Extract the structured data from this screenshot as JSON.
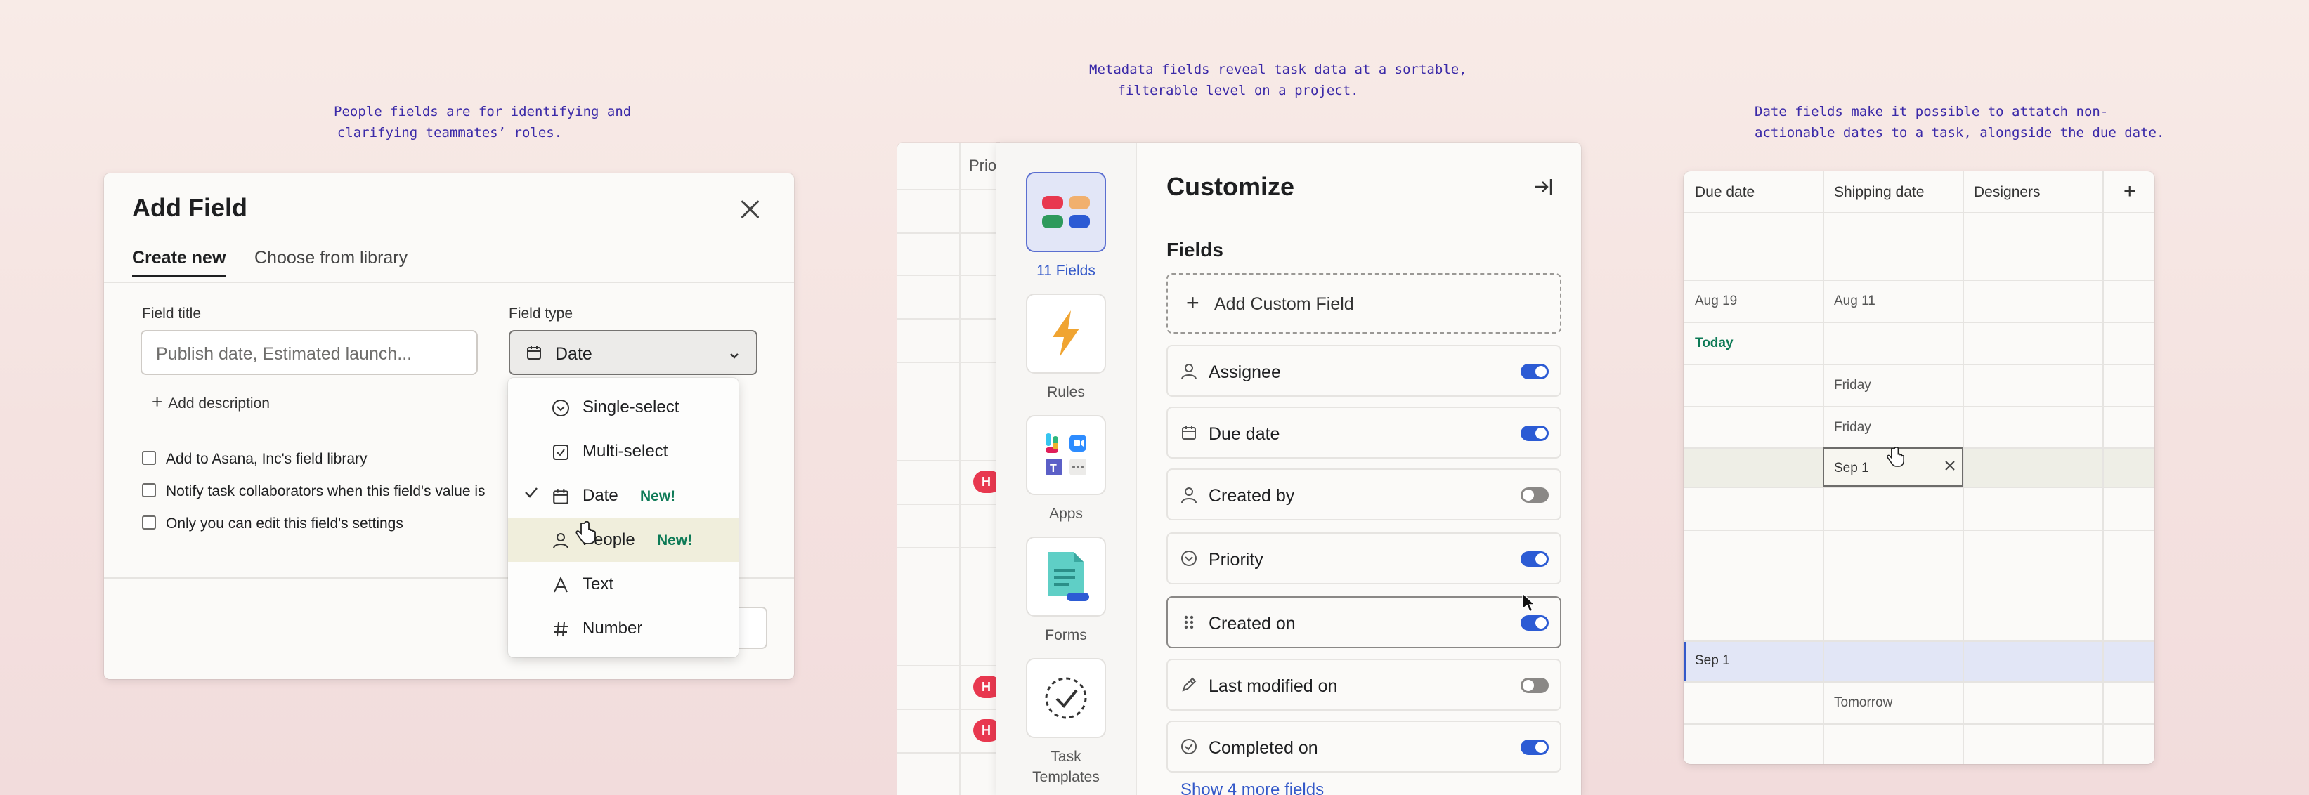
{
  "captions": {
    "people": [
      "People fields are for identifying and",
      "clarifying teammates’ roles."
    ],
    "metadata": [
      "Metadata fields reveal task data at a sortable,",
      "filterable level on a project."
    ],
    "date": [
      "Date fields make it possible to attatch non-",
      "actionable dates to a task,  alongside the due date."
    ]
  },
  "add_field": {
    "title": "Add Field",
    "tabs": [
      "Create new",
      "Choose from library"
    ],
    "field_title_label": "Field title",
    "field_title_placeholder": "Publish date, Estimated launch...",
    "field_type_label": "Field type",
    "field_type_value": "Date",
    "add_description": "Add description",
    "checkboxes": [
      "Add to Asana, Inc's field library",
      "Notify task collaborators when this field's value is",
      "Only you can edit this field's settings"
    ],
    "dropdown": [
      {
        "icon": "circle-chevron-icon",
        "label": "Single-select",
        "badge": "",
        "selected": false
      },
      {
        "icon": "checkbox-icon",
        "label": "Multi-select",
        "badge": "",
        "selected": false
      },
      {
        "icon": "calendar-icon",
        "label": "Date",
        "badge": "New!",
        "selected": true
      },
      {
        "icon": "person-icon",
        "label": "People",
        "badge": "New!",
        "selected": false
      },
      {
        "icon": "text-icon",
        "label": "Text",
        "badge": "",
        "selected": false
      },
      {
        "icon": "hash-icon",
        "label": "Number",
        "badge": "",
        "selected": false
      }
    ]
  },
  "project_grid": {
    "header": "Prio",
    "pill_text": "H"
  },
  "customize": {
    "title": "Customize",
    "rail": [
      {
        "icon": "fields-icon",
        "label": "11 Fields",
        "active": true
      },
      {
        "icon": "lightning-icon",
        "label": "Rules",
        "active": false
      },
      {
        "icon": "apps-icon",
        "label": "Apps",
        "active": false
      },
      {
        "icon": "forms-icon",
        "label": "Forms",
        "active": false
      },
      {
        "icon": "task-templates-icon",
        "label": "Task Templates",
        "active": false
      }
    ],
    "fields_heading": "Fields",
    "add_custom_field": "Add Custom Field",
    "fields": [
      {
        "icon": "person-icon",
        "label": "Assignee",
        "enabled": true
      },
      {
        "icon": "calendar-icon",
        "label": "Due date",
        "enabled": true
      },
      {
        "icon": "person-icon",
        "label": "Created by",
        "enabled": false
      },
      {
        "icon": "circle-chevron-icon",
        "label": "Priority",
        "enabled": true
      },
      {
        "icon": "drag-handle-icon",
        "label": "Created on",
        "enabled": true
      },
      {
        "icon": "pencil-icon",
        "label": "Last modified on",
        "enabled": false
      },
      {
        "icon": "check-circle-icon",
        "label": "Completed on",
        "enabled": true
      }
    ],
    "show_more": "Show 4 more fields"
  },
  "date_table": {
    "headers": [
      "Due date",
      "Shipping date",
      "Designers"
    ],
    "add_column": "+",
    "cells": {
      "r1_due": "Aug 19",
      "r1_ship": "Aug 11",
      "r2_due": "Today",
      "r3_ship": "Friday",
      "r4_ship": "Friday",
      "r5_ship": "Sep 1",
      "r6_due": "Sep 1",
      "r7_ship": "Tomorrow"
    }
  }
}
